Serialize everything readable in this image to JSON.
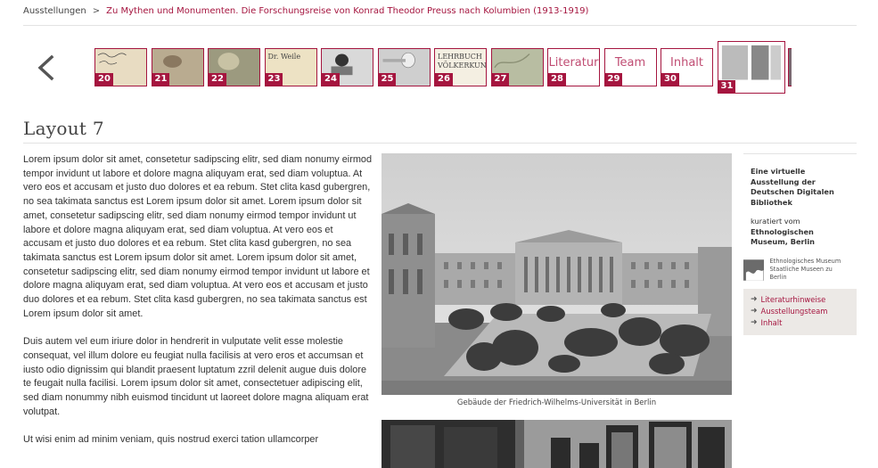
{
  "breadcrumb": {
    "home": "Ausstellungen",
    "separator": ">",
    "current": "Zu Mythen und Monumenten. Die Forschungsreise von Konrad Theodor Preuss nach Kolumbien (1913-1919)"
  },
  "thumbnails": [
    {
      "num": "20",
      "kind": "image",
      "icon": "handwriting-thumbnail"
    },
    {
      "num": "21",
      "kind": "image",
      "icon": "sculpture-thumbnail"
    },
    {
      "num": "22",
      "kind": "image",
      "icon": "statue-thumbnail"
    },
    {
      "num": "23",
      "kind": "image",
      "icon": "note-thumbnail",
      "text": "Dr. Weile"
    },
    {
      "num": "24",
      "kind": "image",
      "icon": "portrait-thumbnail"
    },
    {
      "num": "25",
      "kind": "image",
      "icon": "horn-thumbnail"
    },
    {
      "num": "26",
      "kind": "image",
      "icon": "book-thumbnail",
      "text": "LEHRBUCH VÖLKERKUNDE"
    },
    {
      "num": "27",
      "kind": "image",
      "icon": "map-thumbnail"
    },
    {
      "num": "28",
      "kind": "text",
      "label": "Literatur"
    },
    {
      "num": "29",
      "kind": "text",
      "label": "Team"
    },
    {
      "num": "30",
      "kind": "text",
      "label": "Inhalt"
    },
    {
      "num": "31",
      "kind": "image",
      "icon": "layout-thumbnail",
      "active": true
    }
  ],
  "page_title": "Layout 7",
  "paragraphs": [
    "Lorem ipsum dolor sit amet, consetetur sadipscing elitr, sed diam nonumy eirmod tempor invidunt ut labore et dolore magna aliquyam erat, sed diam voluptua. At vero eos et accusam et justo duo dolores et ea rebum. Stet clita kasd gubergren, no sea takimata sanctus est Lorem ipsum dolor sit amet. Lorem ipsum dolor sit amet, consetetur sadipscing elitr, sed diam nonumy eirmod tempor invidunt ut labore et dolore magna aliquyam erat, sed diam voluptua. At vero eos et accusam et justo duo dolores et ea rebum. Stet clita kasd gubergren, no sea takimata sanctus est Lorem ipsum dolor sit amet. Lorem ipsum dolor sit amet, consetetur sadipscing elitr, sed diam nonumy eirmod tempor invidunt ut labore et dolore magna aliquyam erat, sed diam voluptua. At vero eos et accusam et justo duo dolores et ea rebum. Stet clita kasd gubergren, no sea takimata sanctus est Lorem ipsum dolor sit amet.",
    "Duis autem vel eum iriure dolor in hendrerit in vulputate velit esse molestie consequat, vel illum dolore eu feugiat nulla facilisis at vero eros et accumsan et iusto odio dignissim qui blandit praesent luptatum zzril delenit augue duis dolore te feugait nulla facilisi. Lorem ipsum dolor sit amet, consectetuer adipiscing elit, sed diam nonummy nibh euismod tincidunt ut laoreet dolore magna aliquam erat volutpat.",
    "Ut wisi enim ad minim veniam, quis nostrud exerci tation ullamcorper"
  ],
  "photo_caption": "Gebäude der Friedrich-Wilhelms-Universität in Berlin",
  "sidebar": {
    "intro_bold": "Eine virtuelle Ausstellung der Deutschen Digitalen Bibliothek",
    "curated_label": "kuratiert vom",
    "curator": "Ethnologischen Museum, Berlin",
    "museum_name": "Ethnologisches Museum",
    "museum_sub": "Staatliche Museen zu Berlin",
    "links": [
      "Literaturhinweise",
      "Ausstellungsteam",
      "Inhalt"
    ]
  },
  "colors": {
    "accent": "#a5153f",
    "link_panel": "#ece9e6"
  }
}
